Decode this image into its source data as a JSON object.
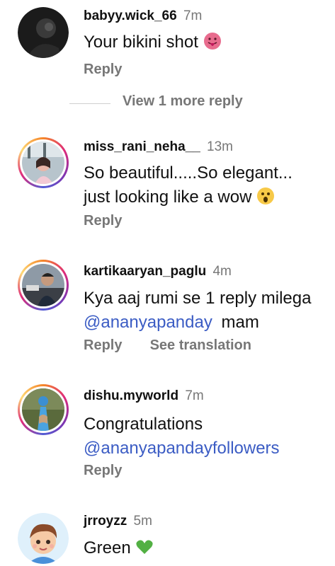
{
  "comments": [
    {
      "username": "babyy.wick_66",
      "time": "7m",
      "text": "Your bikini shot",
      "emoji": "😛",
      "actions": {
        "reply": "Reply"
      }
    },
    {
      "username": "miss_rani_neha__",
      "time": "13m",
      "line1": "So beautiful.....So elegant...",
      "line2": "just looking like a wow",
      "emoji": "😲",
      "actions": {
        "reply": "Reply"
      }
    },
    {
      "username": "kartikaaryan_paglu",
      "time": "4m",
      "line1": "Kya aaj rumi se 1 reply  milega",
      "mention": "@ananyapanday",
      "after_mention": "mam",
      "actions": {
        "reply": "Reply",
        "translate": "See translation"
      }
    },
    {
      "username": "dishu.myworld",
      "time": "7m",
      "line1": "Congratulations",
      "mention": "@ananyapandayfollowers",
      "actions": {
        "reply": "Reply"
      }
    },
    {
      "username": "jrroyzz",
      "time": "5m",
      "text": "Green",
      "emoji": "💚"
    }
  ],
  "view_more": {
    "label": "View 1 more reply"
  },
  "colors": {
    "mention": "#3b5cc4",
    "secondary_text": "#777777",
    "story_ring": "#dd2a7b"
  },
  "icons": {
    "tongue_emoji": "face-with-tongue",
    "astonished_emoji": "astonished-face",
    "heart_emoji": "green-heart"
  }
}
